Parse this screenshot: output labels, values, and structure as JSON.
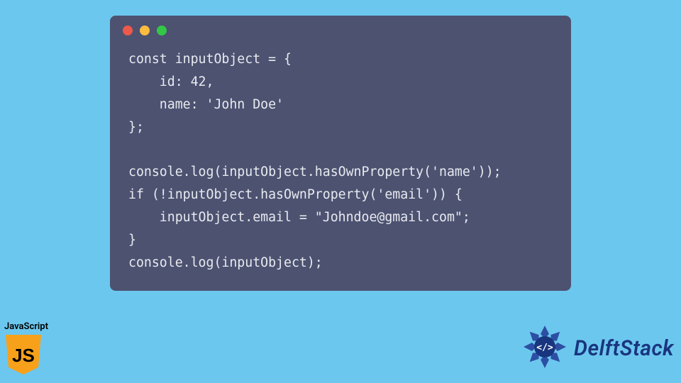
{
  "code": {
    "lines": [
      "const inputObject = {",
      "    id: 42,",
      "    name: 'John Doe'",
      "};",
      "",
      "console.log(inputObject.hasOwnProperty('name'));",
      "if (!inputObject.hasOwnProperty('email')) {",
      "    inputObject.email = \"Johndoe@gmail.com\";",
      "}",
      "console.log(inputObject);"
    ]
  },
  "js_badge": {
    "label": "JavaScript",
    "icon_text": "JS",
    "colors": {
      "bg": "#f7a11b",
      "fg": "#000000"
    }
  },
  "brand": {
    "name": "DelftStack",
    "colors": {
      "primary": "#19357f",
      "accent": "#2d4fa3"
    }
  },
  "window": {
    "dots": [
      "red",
      "yellow",
      "green"
    ]
  }
}
